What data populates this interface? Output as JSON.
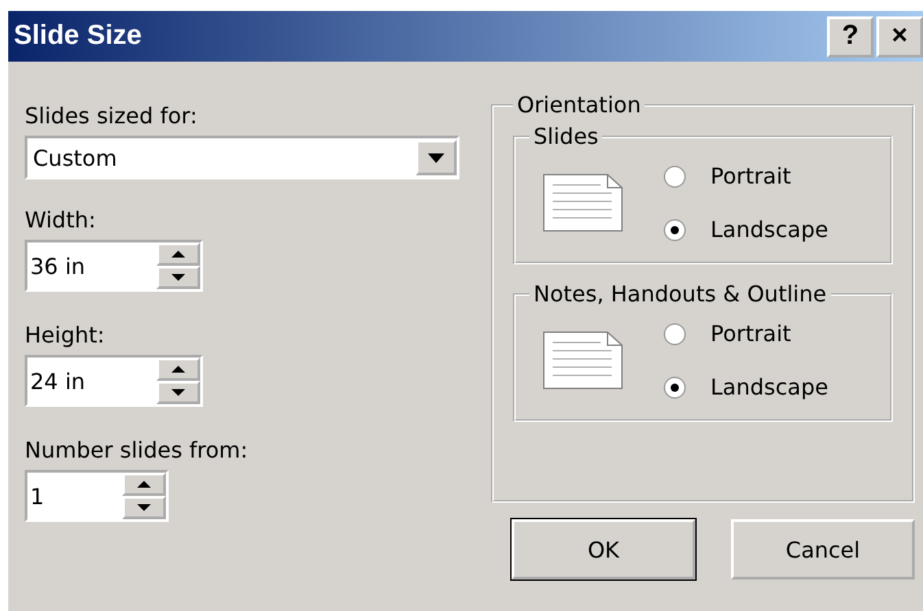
{
  "window": {
    "title": "Slide Size",
    "help_button": "?",
    "close_button": "×"
  },
  "slides_sized_for": {
    "label": "Slides sized for:",
    "value": "Custom"
  },
  "width": {
    "label": "Width:",
    "value": "36 in"
  },
  "height": {
    "label": "Height:",
    "value": "24 in"
  },
  "number_slides_from": {
    "label": "Number slides from:",
    "value": "1"
  },
  "orientation": {
    "title": "Orientation",
    "groups": [
      {
        "title": "Slides",
        "options": [
          {
            "label": "Portrait",
            "selected": false
          },
          {
            "label": "Landscape",
            "selected": true
          }
        ]
      },
      {
        "title": "Notes, Handouts & Outline",
        "options": [
          {
            "label": "Portrait",
            "selected": false
          },
          {
            "label": "Landscape",
            "selected": true
          }
        ]
      }
    ]
  },
  "buttons": [
    {
      "label": "OK",
      "default": true
    },
    {
      "label": "Cancel",
      "default": false
    }
  ]
}
